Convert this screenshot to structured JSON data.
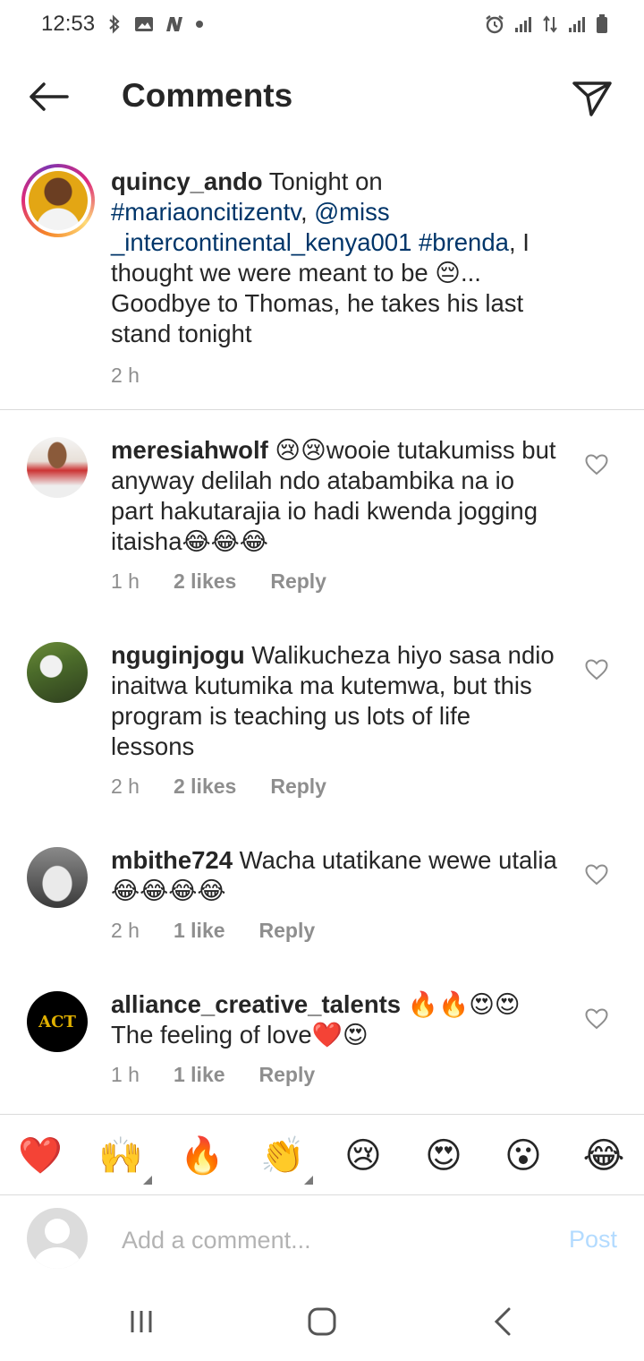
{
  "status_bar": {
    "time": "12:53",
    "left_icons": [
      "bluetooth-icon",
      "image-icon",
      "n-app-icon",
      "dot-icon"
    ],
    "right_icons": [
      "alarm-icon",
      "signal-icon",
      "data-arrows-icon",
      "signal-icon",
      "battery-icon"
    ]
  },
  "header": {
    "title": "Comments",
    "back_icon": "arrow-left-icon",
    "send_icon": "paper-plane-icon"
  },
  "caption": {
    "username": "quincy_ando",
    "text_1": " Tonight on ",
    "hashtag_1": "#mariaoncitizentv",
    "text_2": ", ",
    "mention": "@miss _intercontinental_kenya001",
    "text_3": " ",
    "hashtag_2": "#brenda",
    "text_4": ", I thought we were meant to be 😔... Goodbye to Thomas, he takes his last stand tonight",
    "time": "2 h"
  },
  "comments": [
    {
      "username": "meresiahwolf",
      "text": " 😢😢wooie tutakumiss but anyway delilah ndo atabambika na io part hakutarajia io hadi kwenda jogging itaisha😂😂😂",
      "time": "1 h",
      "likes": "2 likes",
      "reply": "Reply"
    },
    {
      "username": "nguginjogu",
      "text": " Walikucheza hiyo sasa ndio inaitwa kutumika ma kutemwa, but this program is teaching us lots of life lessons",
      "time": "2 h",
      "likes": "2 likes",
      "reply": "Reply"
    },
    {
      "username": "mbithe724",
      "text": " Wacha utatikane wewe utalia 😂😂😂😂",
      "time": "2 h",
      "likes": "1 like",
      "reply": "Reply"
    },
    {
      "username": "alliance_creative_talents",
      "text": " 🔥🔥😍😍The feeling of love❤️😍",
      "time": "1 h",
      "likes": "1 like",
      "reply": "Reply",
      "avatar_logo": "ACT"
    }
  ],
  "emoji_bar": {
    "emojis": [
      "❤️",
      "🙌",
      "🔥",
      "👏",
      "😢",
      "😍",
      "😮",
      "😂"
    ]
  },
  "composer": {
    "placeholder": "Add a comment...",
    "post_label": "Post"
  },
  "colors": {
    "text": "#262626",
    "secondary": "#8e8e8e",
    "link": "#003569",
    "post_disabled": "#b3dbff",
    "divider": "#dbdbdb"
  }
}
